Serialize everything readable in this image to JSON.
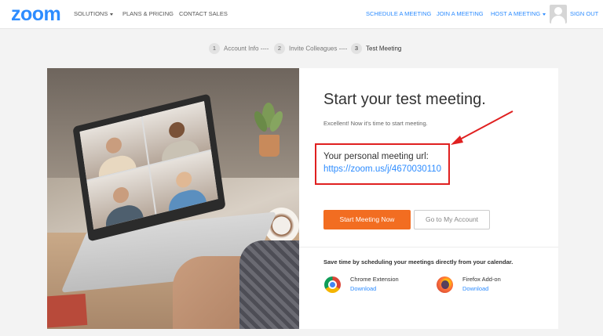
{
  "header": {
    "logo": "zoom",
    "nav_left": [
      {
        "label": "SOLUTIONS",
        "has_caret": true
      },
      {
        "label": "PLANS & PRICING",
        "has_caret": false
      },
      {
        "label": "CONTACT SALES",
        "has_caret": false
      }
    ],
    "nav_right": [
      {
        "label": "SCHEDULE A MEETING"
      },
      {
        "label": "JOIN A MEETING"
      },
      {
        "label": "HOST A MEETING",
        "has_caret": true
      }
    ],
    "sign_out": "SIGN OUT"
  },
  "steps": [
    {
      "num": "1",
      "label": "Account Info ----",
      "active": false
    },
    {
      "num": "2",
      "label": "Invite Colleagues ----",
      "active": false
    },
    {
      "num": "3",
      "label": "Test Meeting",
      "active": true
    }
  ],
  "main": {
    "title": "Start your test meeting.",
    "subtitle": "Excellent! Now it's time to start meeting.",
    "url_label": "Your personal meeting url:",
    "url": "https://zoom.us/j/4670030110",
    "start_button": "Start Meeting Now",
    "account_button": "Go to My Account",
    "schedule_text": "Save time by scheduling your meetings directly from your calendar.",
    "extensions": [
      {
        "name": "Chrome Extension",
        "link": "Download",
        "icon": "chrome-icon"
      },
      {
        "name": "Firefox Add-on",
        "link": "Download",
        "icon": "firefox-icon"
      }
    ]
  },
  "colors": {
    "brand_blue": "#2d8cff",
    "accent_orange": "#f26d21",
    "highlight_red": "#e02020"
  }
}
